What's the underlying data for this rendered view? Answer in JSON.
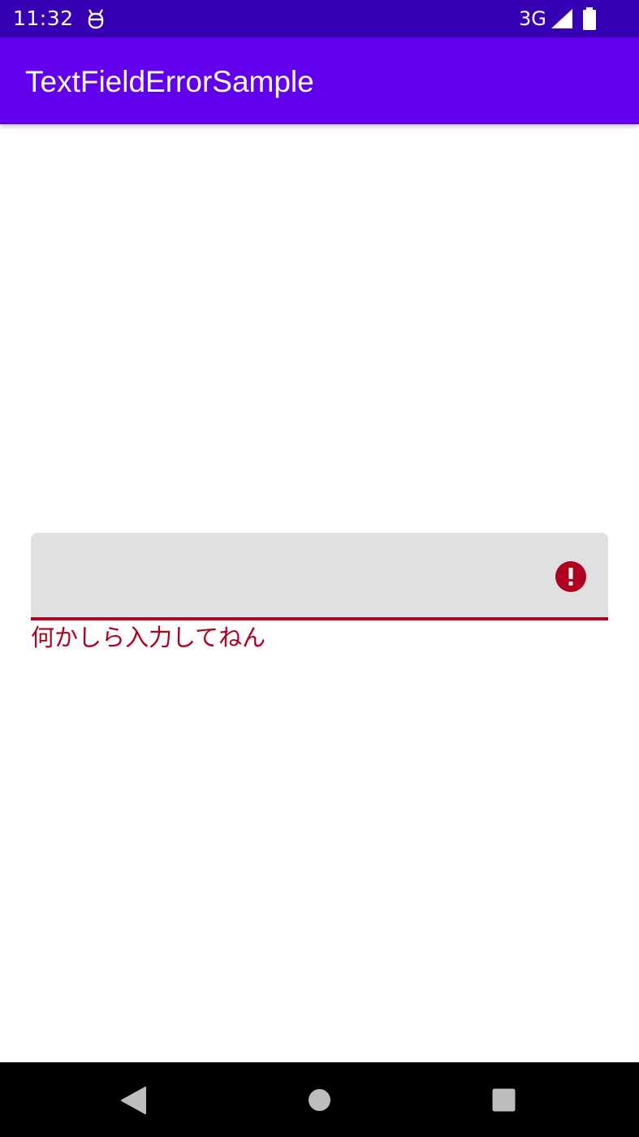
{
  "status_bar": {
    "time": "11:32",
    "notification_icon": "android-debug-icon",
    "network_type": "3G",
    "signal_icon": "cell-signal-icon",
    "battery_icon": "battery-full-icon",
    "background_color": "#3700b3"
  },
  "app_bar": {
    "title": "TextFieldErrorSample",
    "background_color": "#6200ee"
  },
  "text_field": {
    "value": "",
    "state": "error",
    "trailing_icon": "error-icon",
    "error_message": "何かしら入力してねん",
    "error_color": "#b00020",
    "background_color": "#e0e0e0"
  },
  "navigation_bar": {
    "back_icon": "back-triangle-icon",
    "home_icon": "home-circle-icon",
    "recents_icon": "recents-square-icon"
  }
}
